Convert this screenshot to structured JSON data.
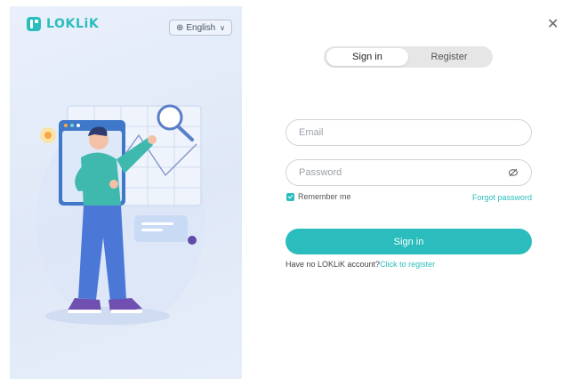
{
  "brand": {
    "name": "LOKLiK",
    "color": "#2bbdbd"
  },
  "language": {
    "icon": "globe-icon",
    "label": "English",
    "chevron": "chevron-down-icon"
  },
  "close_icon": "close-icon",
  "tabs": [
    {
      "label": "Sign in",
      "active": true
    },
    {
      "label": "Register",
      "active": false
    }
  ],
  "form": {
    "email_placeholder": "Email",
    "email_value": "",
    "password_placeholder": "Password",
    "password_value": "",
    "password_toggle_icon": "eye-off-icon",
    "remember_label": "Remember me",
    "remember_checked": true,
    "forgot_label": "Forgot password",
    "submit_label": "Sign in",
    "register_prompt": "Have no LOKLiK account?",
    "register_link": "Click to register"
  },
  "colors": {
    "accent": "#2bbdbd",
    "panel": "#e3ebf8"
  }
}
